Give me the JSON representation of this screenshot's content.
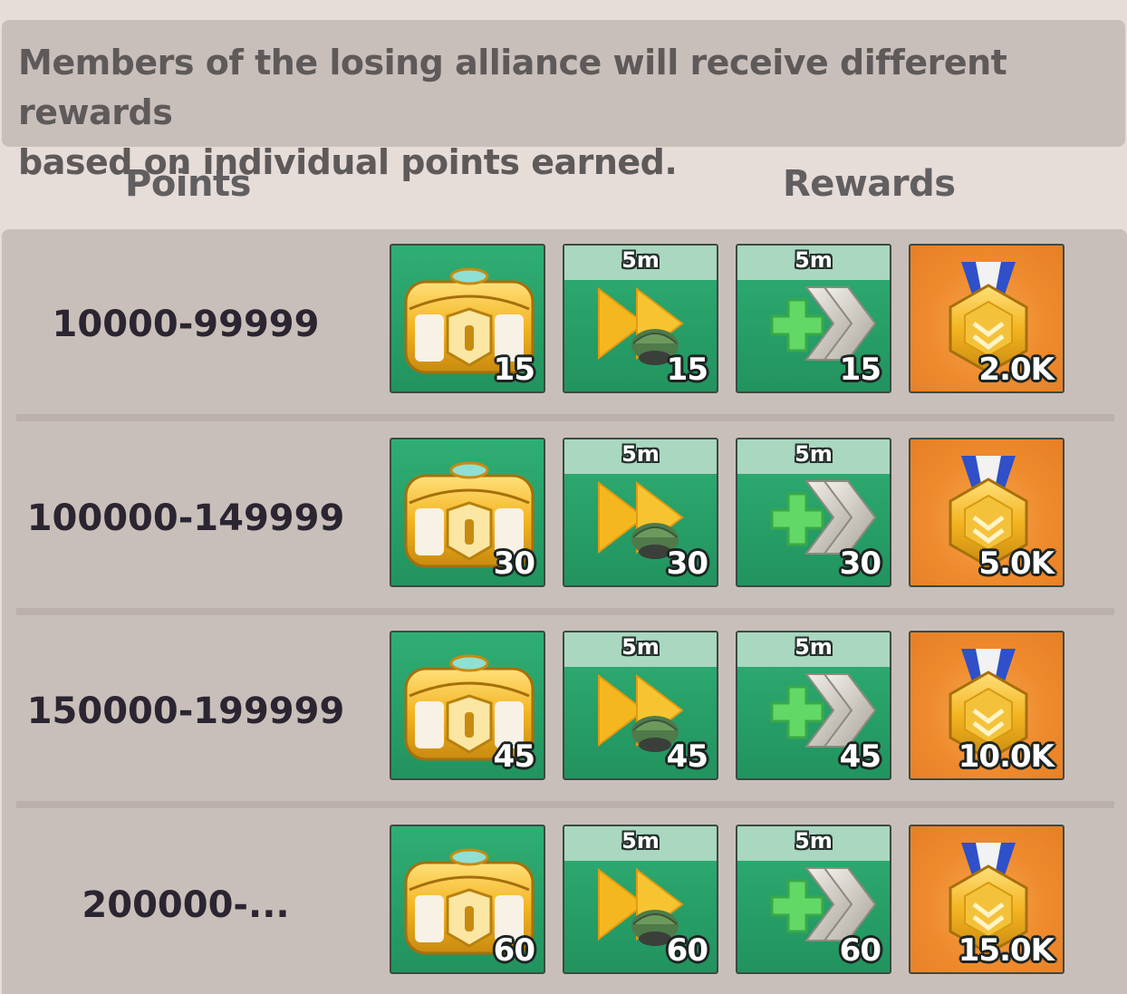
{
  "notice": {
    "line1": "Members of the losing alliance will receive different rewards",
    "line2": "based on individual points earned."
  },
  "headers": {
    "points": "Points",
    "rewards": "Rewards"
  },
  "colors": {
    "accent_green": "#22935e",
    "accent_orange": "#ee8a2d",
    "background": "#e6dcd8",
    "panel": "#c9bfba"
  },
  "tiers": [
    {
      "points": "10000-99999",
      "rewards": [
        {
          "icon": "golden-chest-icon",
          "count": "15"
        },
        {
          "icon": "training-speedup-icon",
          "timer": "5m",
          "count": "15"
        },
        {
          "icon": "healing-speedup-icon",
          "timer": "5m",
          "count": "15"
        },
        {
          "icon": "honor-medal-icon",
          "count": "2.0K"
        }
      ]
    },
    {
      "points": "100000-149999",
      "rewards": [
        {
          "icon": "golden-chest-icon",
          "count": "30"
        },
        {
          "icon": "training-speedup-icon",
          "timer": "5m",
          "count": "30"
        },
        {
          "icon": "healing-speedup-icon",
          "timer": "5m",
          "count": "30"
        },
        {
          "icon": "honor-medal-icon",
          "count": "5.0K"
        }
      ]
    },
    {
      "points": "150000-199999",
      "rewards": [
        {
          "icon": "golden-chest-icon",
          "count": "45"
        },
        {
          "icon": "training-speedup-icon",
          "timer": "5m",
          "count": "45"
        },
        {
          "icon": "healing-speedup-icon",
          "timer": "5m",
          "count": "45"
        },
        {
          "icon": "honor-medal-icon",
          "count": "10.0K"
        }
      ]
    },
    {
      "points": "200000-...",
      "rewards": [
        {
          "icon": "golden-chest-icon",
          "count": "60"
        },
        {
          "icon": "training-speedup-icon",
          "timer": "5m",
          "count": "60"
        },
        {
          "icon": "healing-speedup-icon",
          "timer": "5m",
          "count": "60"
        },
        {
          "icon": "honor-medal-icon",
          "count": "15.0K"
        }
      ]
    }
  ]
}
